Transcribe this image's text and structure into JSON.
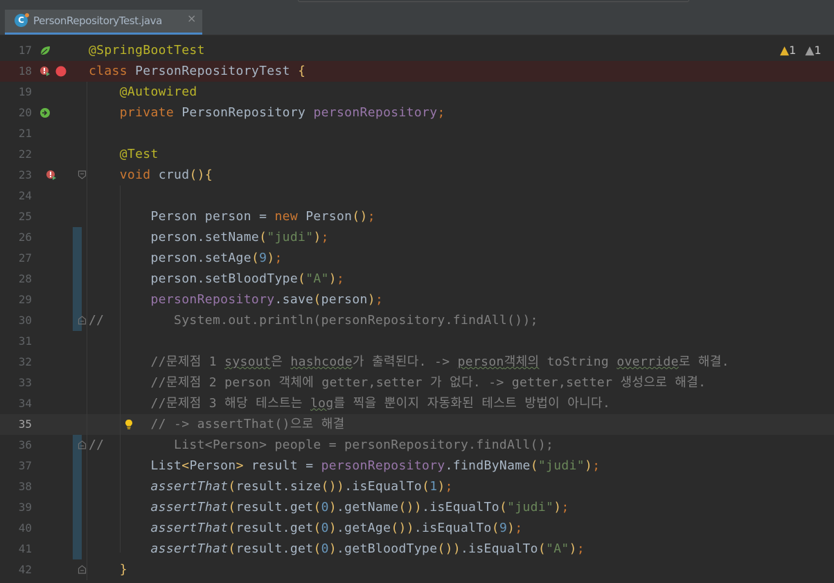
{
  "tab": {
    "file_name": "PersonRepositoryTest.java",
    "close_glyph": "×",
    "icon": "java-class-icon"
  },
  "inspections": {
    "warnings_count": "1",
    "weak_warnings_count": "1",
    "warning_glyph": "▲"
  },
  "colors": {
    "background": "#2b2b2b",
    "keyword": "#cc7832",
    "annotation": "#bbb529",
    "field": "#9876aa",
    "string": "#6a8759",
    "number": "#6897bb",
    "comment": "#808080",
    "breakpoint_line": "#3a2323"
  },
  "lines": [
    {
      "n": "17",
      "tokens": [
        {
          "t": "@SpringBootTest",
          "c": "ann"
        }
      ]
    },
    {
      "n": "18",
      "tokens": [
        {
          "t": "class ",
          "c": "kw"
        },
        {
          "t": "PersonRepositoryTest ",
          "c": ""
        },
        {
          "t": "{",
          "c": "br"
        }
      ]
    },
    {
      "n": "19",
      "tokens": [
        {
          "t": "    @Autowired",
          "c": "ann"
        }
      ]
    },
    {
      "n": "20",
      "tokens": [
        {
          "t": "    private ",
          "c": "kw"
        },
        {
          "t": "PersonRepository ",
          "c": ""
        },
        {
          "t": "personRepository",
          "c": "fld"
        },
        {
          "t": ";",
          "c": "kw"
        }
      ]
    },
    {
      "n": "21",
      "tokens": []
    },
    {
      "n": "22",
      "tokens": [
        {
          "t": "    @Test",
          "c": "ann"
        }
      ]
    },
    {
      "n": "23",
      "tokens": [
        {
          "t": "    void ",
          "c": "kw"
        },
        {
          "t": "crud",
          "c": ""
        },
        {
          "t": "()",
          "c": "br"
        },
        {
          "t": "{",
          "c": "br"
        }
      ]
    },
    {
      "n": "24",
      "tokens": []
    },
    {
      "n": "25",
      "tokens": [
        {
          "t": "        Person person = ",
          "c": ""
        },
        {
          "t": "new ",
          "c": "kw"
        },
        {
          "t": "Person",
          "c": ""
        },
        {
          "t": "()",
          "c": "br"
        },
        {
          "t": ";",
          "c": "kw"
        }
      ]
    },
    {
      "n": "26",
      "tokens": [
        {
          "t": "        person.setName",
          "c": ""
        },
        {
          "t": "(",
          "c": "br"
        },
        {
          "t": "\"judi\"",
          "c": "str"
        },
        {
          "t": ")",
          "c": "br"
        },
        {
          "t": ";",
          "c": "kw"
        }
      ]
    },
    {
      "n": "27",
      "tokens": [
        {
          "t": "        person.setAge",
          "c": ""
        },
        {
          "t": "(",
          "c": "br"
        },
        {
          "t": "9",
          "c": "num"
        },
        {
          "t": ")",
          "c": "br"
        },
        {
          "t": ";",
          "c": "kw"
        }
      ]
    },
    {
      "n": "28",
      "tokens": [
        {
          "t": "        person.setBloodType",
          "c": ""
        },
        {
          "t": "(",
          "c": "br"
        },
        {
          "t": "\"A\"",
          "c": "str"
        },
        {
          "t": ")",
          "c": "br"
        },
        {
          "t": ";",
          "c": "kw"
        }
      ]
    },
    {
      "n": "29",
      "tokens": [
        {
          "t": "        ",
          "c": ""
        },
        {
          "t": "personRepository",
          "c": "fld"
        },
        {
          "t": ".save",
          "c": ""
        },
        {
          "t": "(",
          "c": "br"
        },
        {
          "t": "person",
          "c": ""
        },
        {
          "t": ")",
          "c": "br"
        },
        {
          "t": ";",
          "c": "kw"
        }
      ]
    },
    {
      "n": "30",
      "tokens": [
        {
          "t": "//         System.out.println(personRepository.findAll());",
          "c": "cm"
        }
      ]
    },
    {
      "n": "31",
      "tokens": []
    },
    {
      "n": "32",
      "tokens": [
        {
          "t": "        //문제점 1 ",
          "c": "cm"
        },
        {
          "t": "sysout",
          "c": "cm wv"
        },
        {
          "t": "은 ",
          "c": "cm"
        },
        {
          "t": "hashcode",
          "c": "cm wv"
        },
        {
          "t": "가 출력된다. -> ",
          "c": "cm"
        },
        {
          "t": "person",
          "c": "cm wv"
        },
        {
          "t": "객체의",
          "c": "cm wv"
        },
        {
          "t": " toString ",
          "c": "cm"
        },
        {
          "t": "override",
          "c": "cm wv"
        },
        {
          "t": "로 해결.",
          "c": "cm"
        }
      ]
    },
    {
      "n": "33",
      "tokens": [
        {
          "t": "        //문제점 2 person 객체에 getter,setter 가 없다. -> getter,setter 생성으로 해결.",
          "c": "cm"
        }
      ]
    },
    {
      "n": "34",
      "tokens": [
        {
          "t": "        //문제점 3 해당 테스트는 ",
          "c": "cm"
        },
        {
          "t": "log",
          "c": "cm wv"
        },
        {
          "t": "를 찍을 뿐이지 자동화된 테스트 방법이 아니다.",
          "c": "cm"
        }
      ]
    },
    {
      "n": "35",
      "tokens": [
        {
          "t": "        // -> assertThat()으로 해결",
          "c": "cm"
        }
      ]
    },
    {
      "n": "36",
      "tokens": [
        {
          "t": "//         List<Person> people = personRepository.findAll();",
          "c": "cm"
        }
      ]
    },
    {
      "n": "37",
      "tokens": [
        {
          "t": "        List",
          "c": ""
        },
        {
          "t": "<",
          "c": "br"
        },
        {
          "t": "Person",
          "c": ""
        },
        {
          "t": ">",
          "c": "br"
        },
        {
          "t": " result = ",
          "c": ""
        },
        {
          "t": "personRepository",
          "c": "fld"
        },
        {
          "t": ".findByName",
          "c": ""
        },
        {
          "t": "(",
          "c": "br"
        },
        {
          "t": "\"judi\"",
          "c": "str"
        },
        {
          "t": ")",
          "c": "br"
        },
        {
          "t": ";",
          "c": "kw"
        }
      ]
    },
    {
      "n": "38",
      "tokens": [
        {
          "t": "        ",
          "c": ""
        },
        {
          "t": "assertThat",
          "c": "it"
        },
        {
          "t": "(",
          "c": "br"
        },
        {
          "t": "result.size",
          "c": ""
        },
        {
          "t": "()",
          "c": "br"
        },
        {
          "t": ")",
          "c": "br"
        },
        {
          "t": ".isEqualTo",
          "c": ""
        },
        {
          "t": "(",
          "c": "br"
        },
        {
          "t": "1",
          "c": "num"
        },
        {
          "t": ")",
          "c": "br"
        },
        {
          "t": ";",
          "c": "kw"
        }
      ]
    },
    {
      "n": "39",
      "tokens": [
        {
          "t": "        ",
          "c": ""
        },
        {
          "t": "assertThat",
          "c": "it"
        },
        {
          "t": "(",
          "c": "br"
        },
        {
          "t": "result.get",
          "c": ""
        },
        {
          "t": "(",
          "c": "br"
        },
        {
          "t": "0",
          "c": "num"
        },
        {
          "t": ")",
          "c": "br"
        },
        {
          "t": ".getName",
          "c": ""
        },
        {
          "t": "()",
          "c": "br"
        },
        {
          "t": ")",
          "c": "br"
        },
        {
          "t": ".isEqualTo",
          "c": ""
        },
        {
          "t": "(",
          "c": "br"
        },
        {
          "t": "\"judi\"",
          "c": "str"
        },
        {
          "t": ")",
          "c": "br"
        },
        {
          "t": ";",
          "c": "kw"
        }
      ]
    },
    {
      "n": "40",
      "tokens": [
        {
          "t": "        ",
          "c": ""
        },
        {
          "t": "assertThat",
          "c": "it"
        },
        {
          "t": "(",
          "c": "br"
        },
        {
          "t": "result.get",
          "c": ""
        },
        {
          "t": "(",
          "c": "br"
        },
        {
          "t": "0",
          "c": "num"
        },
        {
          "t": ")",
          "c": "br"
        },
        {
          "t": ".getAge",
          "c": ""
        },
        {
          "t": "()",
          "c": "br"
        },
        {
          "t": ")",
          "c": "br"
        },
        {
          "t": ".isEqualTo",
          "c": ""
        },
        {
          "t": "(",
          "c": "br"
        },
        {
          "t": "9",
          "c": "num"
        },
        {
          "t": ")",
          "c": "br"
        },
        {
          "t": ";",
          "c": "kw"
        }
      ]
    },
    {
      "n": "41",
      "tokens": [
        {
          "t": "        ",
          "c": ""
        },
        {
          "t": "assertThat",
          "c": "it"
        },
        {
          "t": "(",
          "c": "br"
        },
        {
          "t": "result.get",
          "c": ""
        },
        {
          "t": "(",
          "c": "br"
        },
        {
          "t": "0",
          "c": "num"
        },
        {
          "t": ")",
          "c": "br"
        },
        {
          "t": ".getBloodType",
          "c": ""
        },
        {
          "t": "()",
          "c": "br"
        },
        {
          "t": ")",
          "c": "br"
        },
        {
          "t": ".isEqualTo",
          "c": ""
        },
        {
          "t": "(",
          "c": "br"
        },
        {
          "t": "\"A\"",
          "c": "str"
        },
        {
          "t": ")",
          "c": "br"
        },
        {
          "t": ";",
          "c": "kw"
        }
      ]
    },
    {
      "n": "42",
      "tokens": [
        {
          "t": "    }",
          "c": "br"
        }
      ]
    }
  ],
  "gutter_icons": [
    {
      "line": "17",
      "icon": "spring-bean-icon"
    },
    {
      "line": "18",
      "icon": "run-test-icon"
    },
    {
      "line": "18",
      "icon": "breakpoint-icon"
    },
    {
      "line": "20",
      "icon": "spring-autowired-icon"
    },
    {
      "line": "23",
      "icon": "run-test-icon"
    },
    {
      "line": "35",
      "icon": "lightbulb-icon"
    }
  ]
}
